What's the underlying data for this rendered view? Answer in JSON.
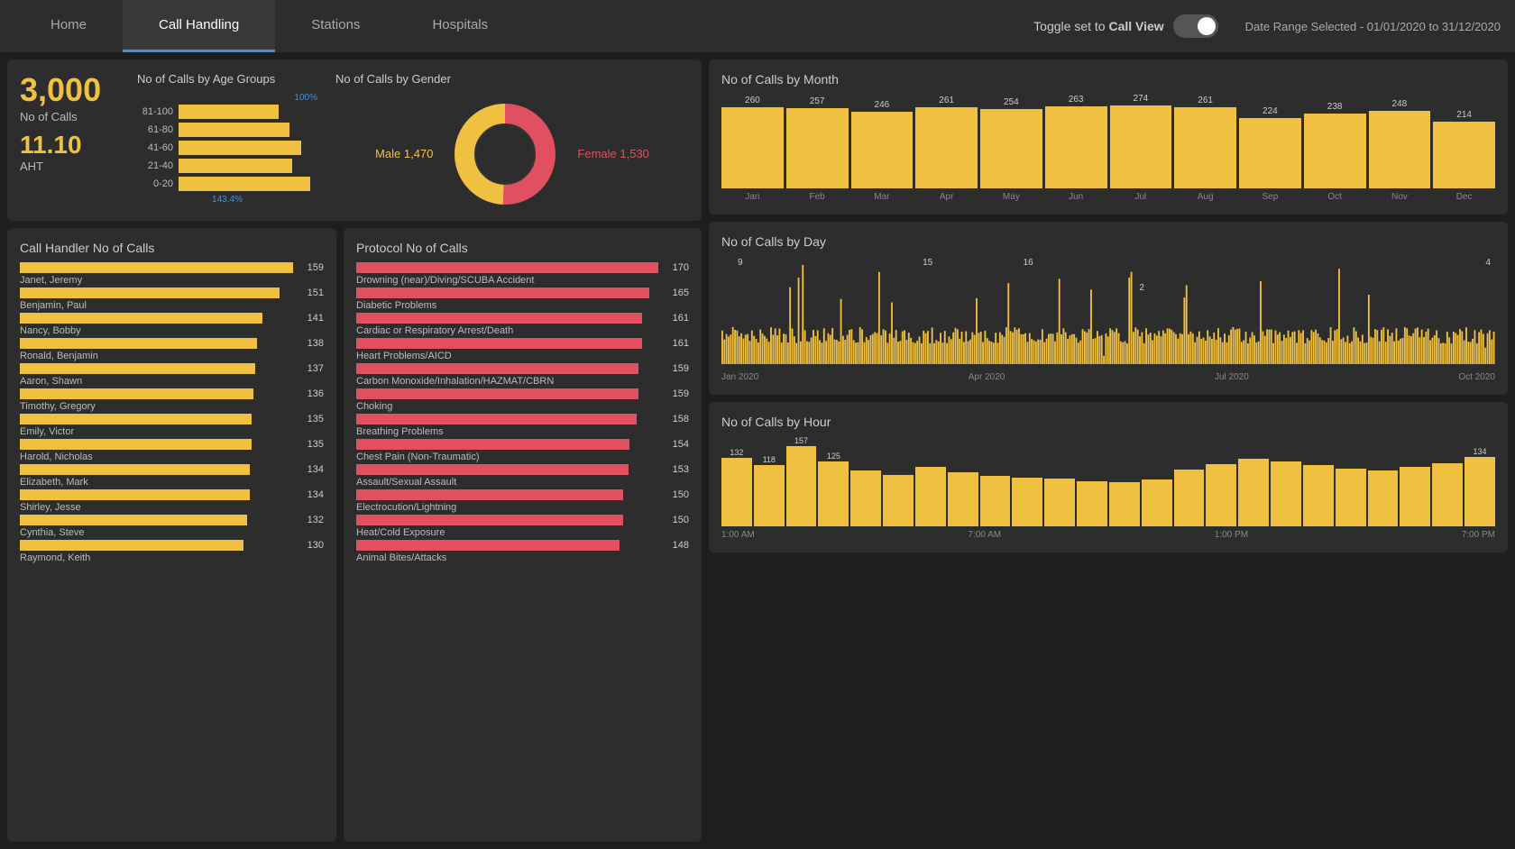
{
  "nav": {
    "tabs": [
      {
        "id": "home",
        "label": "Home"
      },
      {
        "id": "call-handling",
        "label": "Call Handling"
      },
      {
        "id": "stations",
        "label": "Stations"
      },
      {
        "id": "hospitals",
        "label": "Hospitals"
      }
    ],
    "active_tab": "call-handling",
    "toggle_label": "Toggle set to",
    "toggle_mode": "Call View",
    "date_range": "Date Range Selected - 01/01/2020 to 31/12/2020"
  },
  "kpi": {
    "calls_value": "3,000",
    "calls_label": "No of Calls",
    "aht_value": "11.10",
    "aht_label": "AHT"
  },
  "age_groups": {
    "title": "No of Calls by Age Groups",
    "max_label": "100%",
    "items": [
      {
        "label": "81-100",
        "pct": 72
      },
      {
        "label": "61-80",
        "pct": 80
      },
      {
        "label": "41-60",
        "pct": 88
      },
      {
        "label": "21-40",
        "pct": 82
      },
      {
        "label": "0-20",
        "pct": 95
      }
    ],
    "bottom_label": "143.4%"
  },
  "gender": {
    "title": "No of Calls by Gender",
    "male_count": "1,470",
    "female_count": "1,530",
    "male_pct": 49,
    "female_pct": 51
  },
  "call_handlers": {
    "title": "Call Handler No of Calls",
    "items": [
      {
        "name": "Janet, Jeremy",
        "count": 159,
        "max": 159
      },
      {
        "name": "Benjamin, Paul",
        "count": 151,
        "max": 159
      },
      {
        "name": "Nancy, Bobby",
        "count": 141,
        "max": 159
      },
      {
        "name": "Ronald, Benjamin",
        "count": 138,
        "max": 159
      },
      {
        "name": "Aaron, Shawn",
        "count": 137,
        "max": 159
      },
      {
        "name": "Timothy, Gregory",
        "count": 136,
        "max": 159
      },
      {
        "name": "Emily, Victor",
        "count": 135,
        "max": 159
      },
      {
        "name": "Harold, Nicholas",
        "count": 135,
        "max": 159
      },
      {
        "name": "Elizabeth, Mark",
        "count": 134,
        "max": 159
      },
      {
        "name": "Shirley, Jesse",
        "count": 134,
        "max": 159
      },
      {
        "name": "Cynthia, Steve",
        "count": 132,
        "max": 159
      },
      {
        "name": "Raymond, Keith",
        "count": 130,
        "max": 159
      }
    ]
  },
  "protocols": {
    "title": "Protocol No of Calls",
    "items": [
      {
        "name": "Drowning (near)/Diving/SCUBA Accident",
        "count": 170,
        "max": 170
      },
      {
        "name": "Diabetic Problems",
        "count": 165,
        "max": 170
      },
      {
        "name": "Cardiac or Respiratory Arrest/Death",
        "count": 161,
        "max": 170
      },
      {
        "name": "Heart Problems/AICD",
        "count": 161,
        "max": 170
      },
      {
        "name": "Carbon Monoxide/Inhalation/HAZMAT/CBRN",
        "count": 159,
        "max": 170
      },
      {
        "name": "Choking",
        "count": 159,
        "max": 170
      },
      {
        "name": "Breathing Problems",
        "count": 158,
        "max": 170
      },
      {
        "name": "Chest Pain (Non-Traumatic)",
        "count": 154,
        "max": 170
      },
      {
        "name": "Assault/Sexual Assault",
        "count": 153,
        "max": 170
      },
      {
        "name": "Electrocution/Lightning",
        "count": 150,
        "max": 170
      },
      {
        "name": "Heat/Cold Exposure",
        "count": 150,
        "max": 170
      },
      {
        "name": "Animal Bites/Attacks",
        "count": 148,
        "max": 170
      }
    ]
  },
  "calls_by_month": {
    "title": "No of Calls by Month",
    "items": [
      {
        "month": "Jan",
        "count": 260
      },
      {
        "month": "Feb",
        "count": 257
      },
      {
        "month": "Mar",
        "count": 246
      },
      {
        "month": "Apr",
        "count": 261
      },
      {
        "month": "May",
        "count": 254
      },
      {
        "month": "Jun",
        "count": 263
      },
      {
        "month": "Jul",
        "count": 274
      },
      {
        "month": "Aug",
        "count": 261
      },
      {
        "month": "Sep",
        "count": 224
      },
      {
        "month": "Oct",
        "count": 238
      },
      {
        "month": "Nov",
        "count": 248
      },
      {
        "month": "Dec",
        "count": 214
      }
    ],
    "max": 274
  },
  "calls_by_day": {
    "title": "No of Calls by Day",
    "labels": [
      "Jan 2020",
      "Apr 2020",
      "Jul 2020",
      "Oct 2020"
    ],
    "peaks": [
      {
        "label": "9",
        "xpct": 2
      },
      {
        "label": "15",
        "xpct": 27
      },
      {
        "label": "16",
        "xpct": 40
      },
      {
        "label": "2",
        "xpct": 55
      },
      {
        "label": "4",
        "xpct": 97
      }
    ]
  },
  "calls_by_hour": {
    "title": "No of Calls by Hour",
    "items": [
      {
        "hour": "",
        "count": 132,
        "show_val": true
      },
      {
        "hour": "",
        "count": 118,
        "show_val": true
      },
      {
        "hour": "",
        "count": 157,
        "show_val": true
      },
      {
        "hour": "",
        "count": 125,
        "show_val": true
      },
      {
        "hour": "",
        "count": 108,
        "show_val": false
      },
      {
        "hour": "",
        "count": 100,
        "show_val": false
      },
      {
        "hour": "",
        "count": 115,
        "show_val": false
      },
      {
        "hour": "",
        "count": 105,
        "show_val": false
      },
      {
        "hour": "",
        "count": 98,
        "show_val": false
      },
      {
        "hour": "",
        "count": 95,
        "show_val": false
      },
      {
        "hour": "",
        "count": 92,
        "show_val": false
      },
      {
        "hour": "",
        "count": 88,
        "show_val": false
      },
      {
        "hour": "",
        "count": 85,
        "show_val": false
      },
      {
        "hour": "",
        "count": 90,
        "show_val": false
      },
      {
        "hour": "",
        "count": 110,
        "show_val": false
      },
      {
        "hour": "",
        "count": 120,
        "show_val": false
      },
      {
        "hour": "",
        "count": 130,
        "show_val": false
      },
      {
        "hour": "",
        "count": 125,
        "show_val": false
      },
      {
        "hour": "",
        "count": 118,
        "show_val": false
      },
      {
        "hour": "",
        "count": 112,
        "show_val": false
      },
      {
        "hour": "",
        "count": 108,
        "show_val": false
      },
      {
        "hour": "",
        "count": 115,
        "show_val": false
      },
      {
        "hour": "",
        "count": 122,
        "show_val": false
      },
      {
        "hour": "",
        "count": 134,
        "show_val": true
      }
    ],
    "labels": [
      "1:00 AM",
      "7:00 AM",
      "1:00 PM",
      "7:00 PM"
    ],
    "max": 157
  }
}
